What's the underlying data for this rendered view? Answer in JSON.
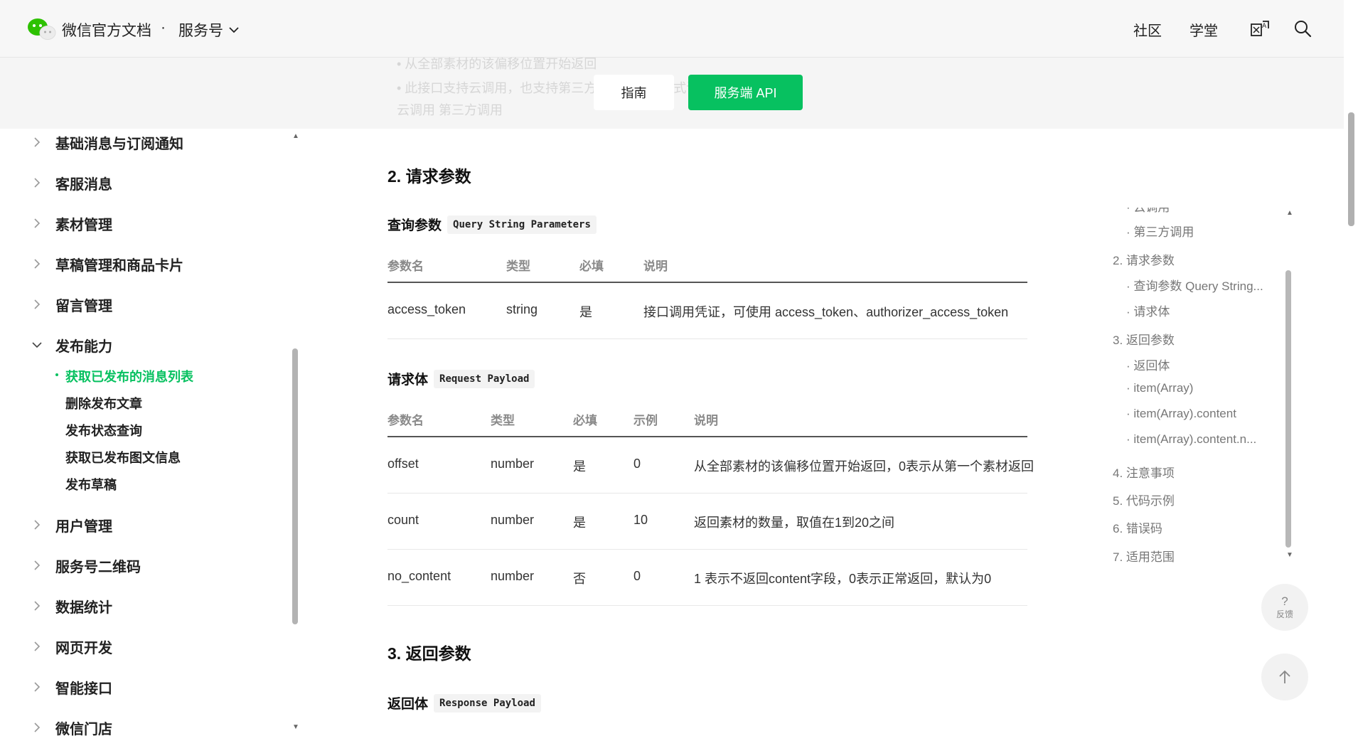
{
  "header": {
    "brand": "微信官方文档",
    "dot": "·",
    "section": "服务号",
    "nav": [
      "社区",
      "学堂"
    ],
    "icons": [
      "translate-icon",
      "search-icon"
    ]
  },
  "doc_tabs": {
    "guide": "指南",
    "server_api": "服务端 API",
    "faded_lines": [
      "• 从全部素材的该偏移位置开始返回",
      "• 此接口支持云调用，也支持第三方调用，调用方式请参考",
      "  云调用 第三方调用"
    ]
  },
  "sidebar": {
    "items": [
      {
        "label": "基础消息与订阅通知",
        "expanded": false
      },
      {
        "label": "客服消息",
        "expanded": false
      },
      {
        "label": "素材管理",
        "expanded": false
      },
      {
        "label": "草稿管理和商品卡片",
        "expanded": false
      },
      {
        "label": "留言管理",
        "expanded": false
      },
      {
        "label": "发布能力",
        "expanded": true
      },
      {
        "label": "用户管理",
        "expanded": false
      },
      {
        "label": "服务号二维码",
        "expanded": false
      },
      {
        "label": "数据统计",
        "expanded": false
      },
      {
        "label": "网页开发",
        "expanded": false
      },
      {
        "label": "智能接口",
        "expanded": false
      },
      {
        "label": "微信门店",
        "expanded": false
      }
    ],
    "subitems": [
      {
        "label": "获取已发布的消息列表",
        "active": true
      },
      {
        "label": "删除发布文章",
        "active": false
      },
      {
        "label": "发布状态查询",
        "active": false
      },
      {
        "label": "获取已发布图文信息",
        "active": false
      },
      {
        "label": "发布草稿",
        "active": false
      }
    ]
  },
  "main": {
    "section2_title": "2. 请求参数",
    "query_title": "查询参数",
    "query_tag": "Query String Parameters",
    "query_headers": [
      "参数名",
      "类型",
      "必填",
      "说明"
    ],
    "query_rows": [
      {
        "name": "access_token",
        "type": "string",
        "required": "是",
        "desc_prefix": "接口调用凭证，可使用 ",
        "link1": "access_token",
        "sep": "、",
        "link2": "authorizer_access_token"
      }
    ],
    "body_title": "请求体",
    "body_tag": "Request Payload",
    "body_headers": [
      "参数名",
      "类型",
      "必填",
      "示例",
      "说明"
    ],
    "body_rows": [
      {
        "name": "offset",
        "type": "number",
        "required": "是",
        "example": "0",
        "desc": "从全部素材的该偏移位置开始返回，0表示从第一个素材返回"
      },
      {
        "name": "count",
        "type": "number",
        "required": "是",
        "example": "10",
        "desc": "返回素材的数量，取值在1到20之间"
      },
      {
        "name": "no_content",
        "type": "number",
        "required": "否",
        "example": "0",
        "desc": "1 表示不返回content字段，0表示正常返回，默认为0"
      }
    ],
    "section3_title": "3. 返回参数",
    "resp_title": "返回体",
    "resp_tag": "Response Payload"
  },
  "toc": {
    "items": [
      {
        "label": "· 云调用",
        "level": 2
      },
      {
        "label": "· 第三方调用",
        "level": 2
      },
      {
        "label": "2. 请求参数",
        "level": 1
      },
      {
        "label": "· 查询参数 Query String...",
        "level": 2
      },
      {
        "label": "· 请求体",
        "level": 2
      },
      {
        "label": "3. 返回参数",
        "level": 1
      },
      {
        "label": "· 返回体",
        "level": 2
      },
      {
        "label": "· item(Array)",
        "level": 2
      },
      {
        "label": "· item(Array).content",
        "level": 2
      },
      {
        "label": "· item(Array).content.n...",
        "level": 2
      },
      {
        "label": "4. 注意事项",
        "level": 1
      },
      {
        "label": "5. 代码示例",
        "level": 1
      },
      {
        "label": "6. 错误码",
        "level": 1
      },
      {
        "label": "7. 适用范围",
        "level": 1
      }
    ]
  },
  "float": {
    "feedback_q": "?",
    "feedback_label": "反馈"
  },
  "colors": {
    "accent": "#07c160",
    "link": "#576b95"
  }
}
